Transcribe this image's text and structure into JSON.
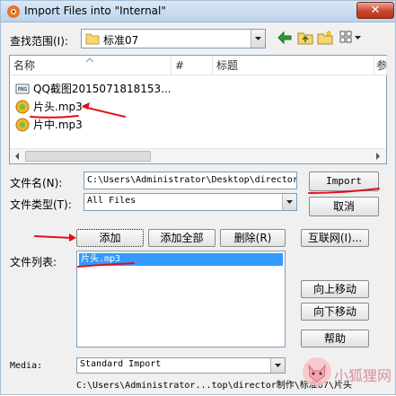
{
  "window": {
    "title": "Import Files into \"Internal\"",
    "close_label": "✕"
  },
  "look_in": {
    "label": "查找范围(I):",
    "value": "标准07"
  },
  "columns": [
    "名称",
    "#",
    "标题",
    "参"
  ],
  "files": [
    {
      "name": "QQ截图2015071818153...",
      "icon": "image-file-icon"
    },
    {
      "name": "片头.mp3",
      "icon": "audio-file-icon"
    },
    {
      "name": "片中.mp3",
      "icon": "audio-file-icon"
    }
  ],
  "file_name": {
    "label": "文件名(N):",
    "value": "C:\\Users\\Administrator\\Desktop\\director"
  },
  "file_type": {
    "label": "文件类型(T):",
    "value": "All Files"
  },
  "buttons": {
    "import": "Import",
    "cancel": "取消",
    "add": "添加",
    "add_all": "添加全部",
    "remove": "删除(R)",
    "internet": "互联网(I)...",
    "move_up": "向上移动",
    "move_down": "向下移动",
    "help": "帮助"
  },
  "file_list": {
    "label": "文件列表:",
    "items": [
      "片头.mp3"
    ]
  },
  "media": {
    "label": "Media:",
    "value": "Standard Import"
  },
  "path_text": "C:\\Users\\Administrator...top\\director制作\\标准07\\片头",
  "watermark_text": "小狐狸网",
  "colors": {
    "annotation_red": "#e0101a",
    "selection_blue": "#3399ff",
    "title_gradient_top": "#dbe8f6"
  }
}
